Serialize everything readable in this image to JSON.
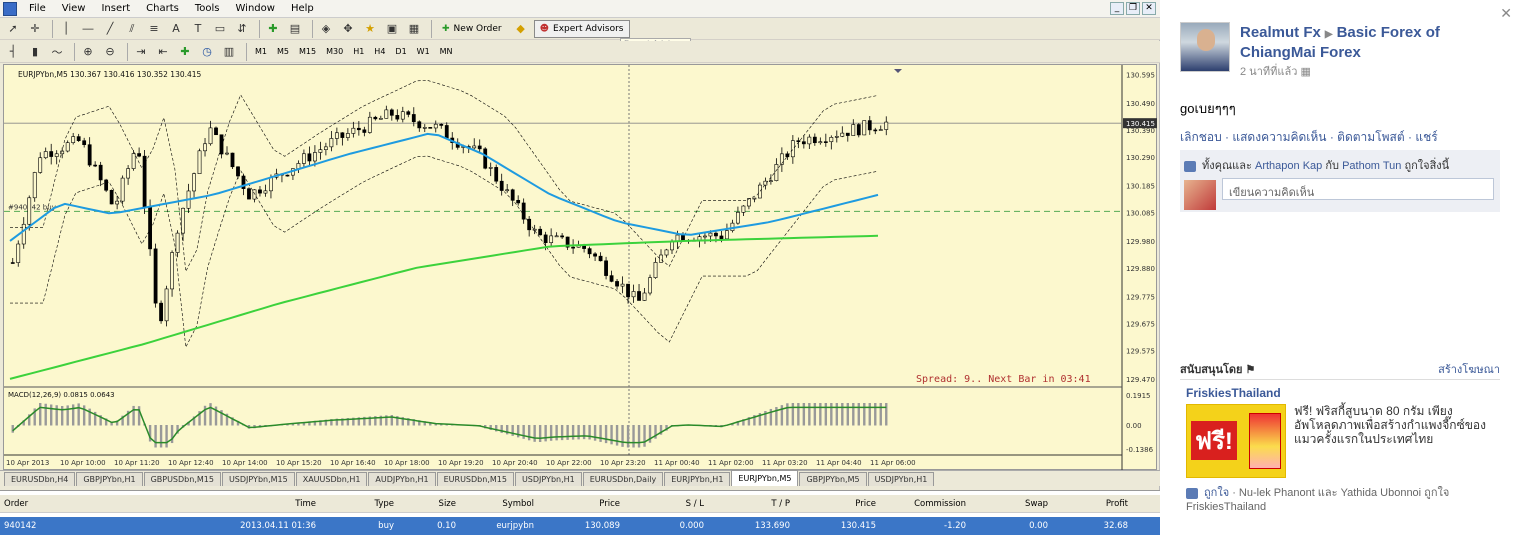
{
  "menu": [
    "File",
    "View",
    "Insert",
    "Charts",
    "Tools",
    "Window",
    "Help"
  ],
  "toolbar": {
    "new_order": "New Order",
    "expert_advisors": "Expert Advisors",
    "tooltip": "Expert Advisors"
  },
  "timeframes": [
    "M1",
    "M5",
    "M15",
    "M30",
    "H1",
    "H4",
    "D1",
    "W1",
    "MN"
  ],
  "chart": {
    "header": "EURJPYbn,M5  130.367 130.416 130.352 130.415",
    "ticket_marker": "#940142 buy",
    "current_price": "130.415",
    "spread_text": "Spread: 9.. Next Bar in 03:41",
    "price_ticks": [
      "130.595",
      "130.490",
      "130.390",
      "130.290",
      "130.185",
      "130.085",
      "129.980",
      "129.880",
      "129.775",
      "129.675",
      "129.575",
      "129.470"
    ],
    "macd_label": "MACD(12,26,9) 0.0815 0.0643",
    "macd_ticks": [
      "0.1915",
      "0.00",
      "-0.1386"
    ],
    "time_ticks": [
      "10 Apr 2013",
      "10 Apr 10:00",
      "10 Apr 11:20",
      "10 Apr 12:40",
      "10 Apr 14:00",
      "10 Apr 15:20",
      "10 Apr 16:40",
      "10 Apr 18:00",
      "10 Apr 19:20",
      "10 Apr 20:40",
      "10 Apr 22:00",
      "10 Apr 23:20",
      "11 Apr 00:40",
      "11 Apr 02:00",
      "11 Apr 03:20",
      "11 Apr 04:40",
      "11 Apr 06:00"
    ],
    "colors": {
      "bg": "#fcf8ce",
      "ma_fast": "#1e9be0",
      "ma_slow": "#3cd23c",
      "candle": "#000000",
      "bands": "#000000",
      "spread": "#b03030"
    }
  },
  "tabs": [
    "EURUSDbn,H4",
    "GBPJPYbn,H1",
    "GBPUSDbn,M15",
    "USDJPYbn,M15",
    "XAUUSDbn,H1",
    "AUDJPYbn,H1",
    "EURUSDbn,M15",
    "USDJPYbn,H1",
    "EURUSDbn,Daily",
    "EURJPYbn,H1",
    "EURJPYbn,M5",
    "GBPJPYbn,M5",
    "USDJPYbn,H1"
  ],
  "active_tab": "EURJPYbn,M5",
  "terminal": {
    "headers": [
      "Order",
      "Time",
      "Type",
      "Size",
      "Symbol",
      "Price",
      "S / L",
      "T / P",
      "Price",
      "Commission",
      "Swap",
      "Profit"
    ],
    "row": [
      "940142",
      "2013.04.11 01:36",
      "buy",
      "0.10",
      "eurjpybn",
      "130.089",
      "0.000",
      "133.690",
      "130.415",
      "-1.20",
      "0.00",
      "32.68"
    ]
  },
  "fb": {
    "poster": "Realmut Fx",
    "page": "Basic Forex of ChiangMai Forex",
    "time": "2 นาทีที่แล้ว",
    "text": "goเบยๆๆๆ",
    "actions": "เลิกชอบ · แสดงความคิดเห็น · ติดตามโพสต์ · แชร์",
    "likes_prefix": "ทั้งคุณและ",
    "liker1": "Arthapon Kap",
    "likes_mid": "กับ",
    "liker2": "Pathom Tun",
    "likes_suffix": "ถูกใจสิ่งนี้",
    "comment_placeholder": "เขียนความคิดเห็น",
    "sponsored": "สนับสนุนโดย",
    "create_ad": "สร้างโฆษณา",
    "ad_title": "FriskiesThailand",
    "ad_free": "ฟรี!",
    "ad_text": "ฟรี! ฟริสกี้สูบนาด 80 กรัม เพียงอัพโหลดภาพเพื่อสร้างกำแพงจี๊กซ์ของแมวครั้งแรกในประเทศไทย",
    "ad_like_word": "ถูกใจ",
    "ad_likes": "Nu-lek Phanont และ Yathida Ubonnoi ถูกใจ FriskiesThailand"
  }
}
